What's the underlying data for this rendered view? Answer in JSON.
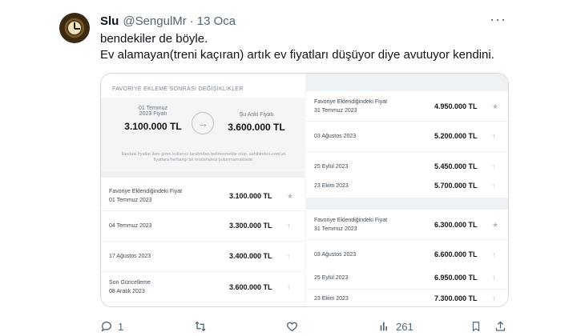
{
  "tweet": {
    "author_name": "Slu",
    "author_handle": "@SengulMr",
    "separator": "·",
    "date": "13 Oca",
    "more": "···",
    "text_line1": "bendekiler de böyle.",
    "text_line2": "Ev alamayan(treni kaçıran) artık ev fiyatları düşüyor diye avutuyor kendini."
  },
  "card": {
    "left": {
      "section_title": "FAVORİYE EKLEME SONRASI DEĞİŞİKLİKLER",
      "from_label_1": "01 Temmuz",
      "from_label_2": "2023 Fiyatı",
      "from_price": "3.100.000 TL",
      "to_label": "Şu Anki Fiyatı",
      "to_price": "3.600.000 TL",
      "note": "İlandaki fiyatlar ilanı giren kullanıcı tarafından belirlenmekte olup, sahibinden.com'un fiyatlara herhangi bir müdahalesi bulunmamaktadır.",
      "rows": [
        {
          "label": "Favoriye Eklendiğindeki Fiyat",
          "date": "01 Temmuz 2023",
          "price": "3.100.000 TL",
          "icon": "★"
        },
        {
          "label": "",
          "date": "04 Temmuz 2023",
          "price": "3.300.000 TL",
          "icon": "↑"
        },
        {
          "label": "",
          "date": "17 Ağustos 2023",
          "price": "3.400.000 TL",
          "icon": "↑"
        },
        {
          "label": "Son Güncelleme",
          "date": "08 Aralık 2023",
          "price": "3.600.000 TL",
          "icon": "↑"
        }
      ]
    },
    "right": {
      "group1": [
        {
          "label": "Favoriye Eklendiğindeki Fiyat",
          "date": "31 Temmuz 2023",
          "price": "4.950.000 TL",
          "icon": "★"
        },
        {
          "label": "",
          "date": "03 Ağustos 2023",
          "price": "5.200.000 TL",
          "icon": "↑"
        },
        {
          "label": "",
          "date": "25 Eylül 2023",
          "price": "5.450.000 TL",
          "icon": "↑"
        },
        {
          "label": "",
          "date": "23 Ekim 2023",
          "price": "5.700.000 TL",
          "icon": "↑"
        }
      ],
      "group2": [
        {
          "label": "Favoriye Eklendiğindeki Fiyat",
          "date": "31 Temmuz 2023",
          "price": "6.300.000 TL",
          "icon": "★"
        },
        {
          "label": "",
          "date": "03 Ağustos 2023",
          "price": "6.600.000 TL",
          "icon": "↑"
        },
        {
          "label": "",
          "date": "25 Eylül 2023",
          "price": "6.950.000 TL",
          "icon": "↑"
        },
        {
          "label": "",
          "date": "23 Ekim 2023",
          "price": "7.300.000 TL",
          "icon": "↑"
        }
      ]
    }
  },
  "actions": {
    "replies": "1",
    "retweets": "",
    "likes": "",
    "views": "261"
  }
}
